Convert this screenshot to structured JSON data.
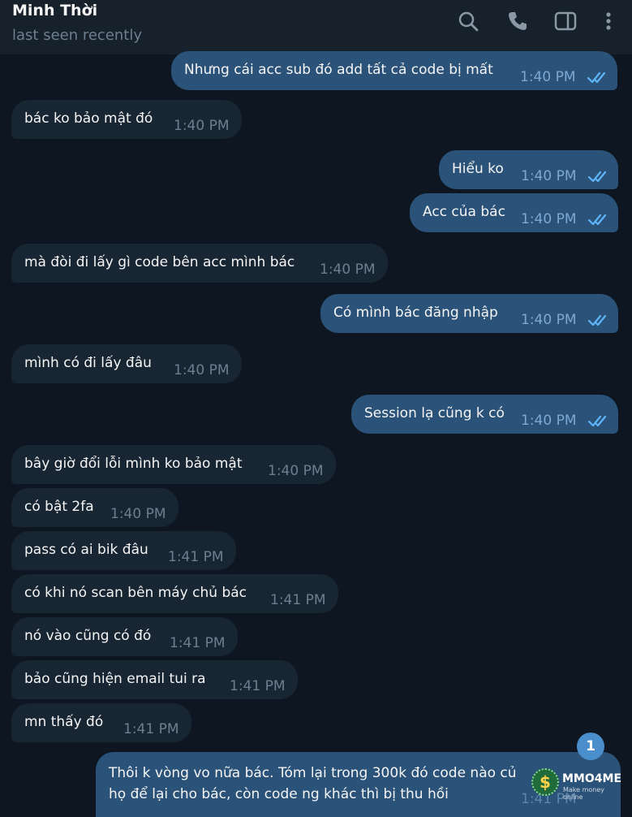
{
  "header": {
    "contact_name": "Minh Thời",
    "status": "last seen recently",
    "icons": [
      "search-icon",
      "phone-icon",
      "sidebar-toggle-icon",
      "more-vert-icon"
    ]
  },
  "messages": [
    {
      "dir": "out",
      "text": "Nhưng cái acc sub đó add tất cả code bị mất",
      "time": "1:40 PM"
    },
    {
      "dir": "in",
      "text": "bác ko bảo mật đó",
      "time": "1:40 PM"
    },
    {
      "dir": "out",
      "text": "Hiểu ko",
      "time": "1:40 PM"
    },
    {
      "dir": "out",
      "text": "Acc của bác",
      "time": "1:40 PM"
    },
    {
      "dir": "in",
      "text": "mà đòi đi lấy gì code bên acc mình bác",
      "time": "1:40 PM"
    },
    {
      "dir": "out",
      "text": "Có mình bác đăng nhập",
      "time": "1:40 PM"
    },
    {
      "dir": "in",
      "text": "mình có đi lấy đâu",
      "time": "1:40 PM"
    },
    {
      "dir": "out",
      "text": "Session lạ cũng k có",
      "time": "1:40 PM"
    },
    {
      "dir": "in",
      "text": "bây giờ đổi lỗi mình ko bảo mật",
      "time": "1:40 PM"
    },
    {
      "dir": "in",
      "text": "có bật 2fa",
      "time": "1:40 PM"
    },
    {
      "dir": "in",
      "text": "pass có ai bik đâu",
      "time": "1:41 PM"
    },
    {
      "dir": "in",
      "text": "có khi nó scan bên máy chủ bác",
      "time": "1:41 PM"
    },
    {
      "dir": "in",
      "text": "nó vào cũng có đó",
      "time": "1:41 PM"
    },
    {
      "dir": "in",
      "text": "bảo cũng hiện email tui ra",
      "time": "1:41 PM"
    },
    {
      "dir": "in",
      "text": "mn thấy đó",
      "time": "1:41 PM"
    }
  ],
  "last_message": {
    "line1": "Thôi k vòng vo nữa bác. Tóm lại trong 300k đó code nào củ",
    "line2": "họ để lại cho bác, còn code ng khác thì bị thu hồi",
    "time": "1:41 PM"
  },
  "unread_badge": "1",
  "watermark": {
    "brand": "MMO4ME",
    "tagline": "Make money online",
    "symbol": "$"
  },
  "colors": {
    "background": "#0e1621",
    "header": "#17212b",
    "incoming_bubble": "#182533",
    "outgoing_bubble": "#2b5278",
    "time_gray": "#6d7f8f",
    "read_ticks": "#5eb5f7"
  }
}
